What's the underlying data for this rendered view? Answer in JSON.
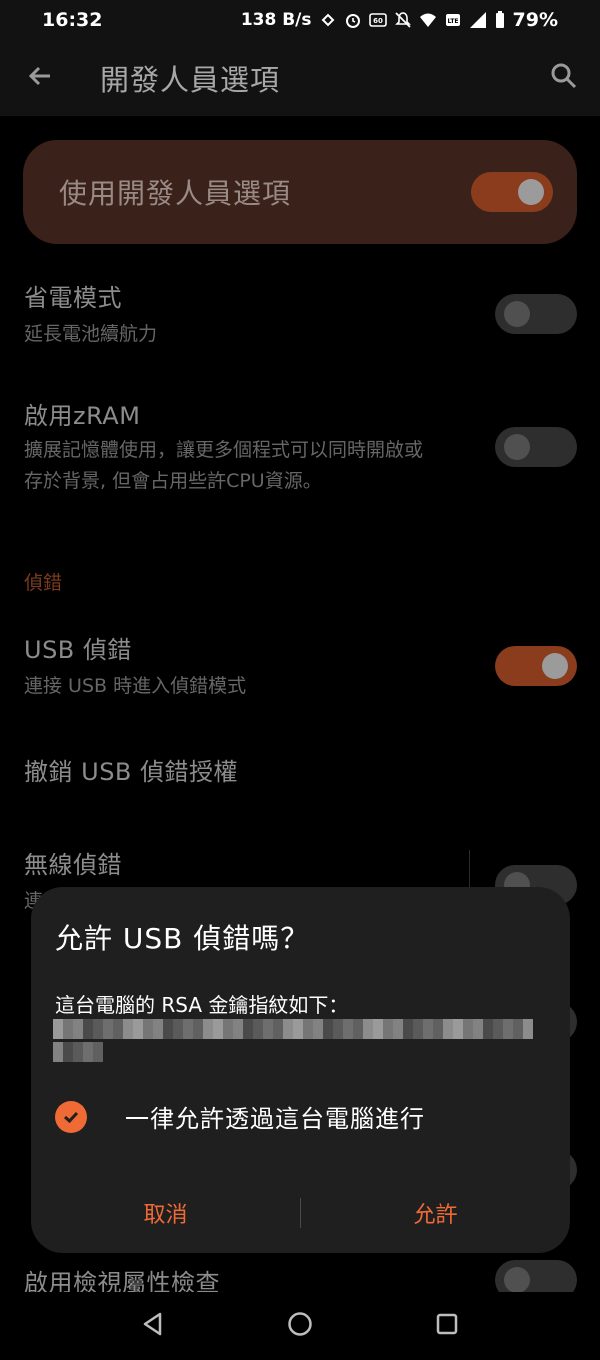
{
  "status_bar": {
    "time": "16:32",
    "net_speed": "138 B/s",
    "battery": "79%"
  },
  "app_bar": {
    "title": "開發人員選項",
    "back_icon": "arrow-back-icon",
    "search_icon": "search-icon"
  },
  "master_toggle": {
    "label": "使用開發人員選項",
    "on": true
  },
  "settings": {
    "battery_saver": {
      "title": "省電模式",
      "subtitle": "延長電池續航力",
      "on": false
    },
    "zram": {
      "title": "啟用zRAM",
      "subtitle_line1": "擴展記憶體使用，讓更多個程式可以同時開啟或",
      "subtitle_line2": "存於背景, 但會占用些許CPU資源。",
      "on": false
    },
    "debug_section": "偵錯",
    "usb_debug": {
      "title": "USB 偵錯",
      "subtitle": "連接 USB 時進入偵錯模式",
      "on": true
    },
    "revoke_usb": {
      "title": "撤銷 USB 偵錯授權"
    },
    "wireless_debug": {
      "title": "無線偵錯",
      "subtitle_partial": "連",
      "on": false
    },
    "view_attr": {
      "title": "啟用檢視屬性檢查",
      "on": false
    }
  },
  "dialog": {
    "title": "允許 USB 偵錯嗎？",
    "message": "這台電腦的 RSA 金鑰指紋如下：",
    "always_allow": "一律允許透過這台電腦進行",
    "always_allow_checked": true,
    "cancel": "取消",
    "allow": "允許"
  },
  "colors": {
    "accent": "#f06a35",
    "background": "#000000",
    "dialog_bg": "#1f1f1f"
  }
}
